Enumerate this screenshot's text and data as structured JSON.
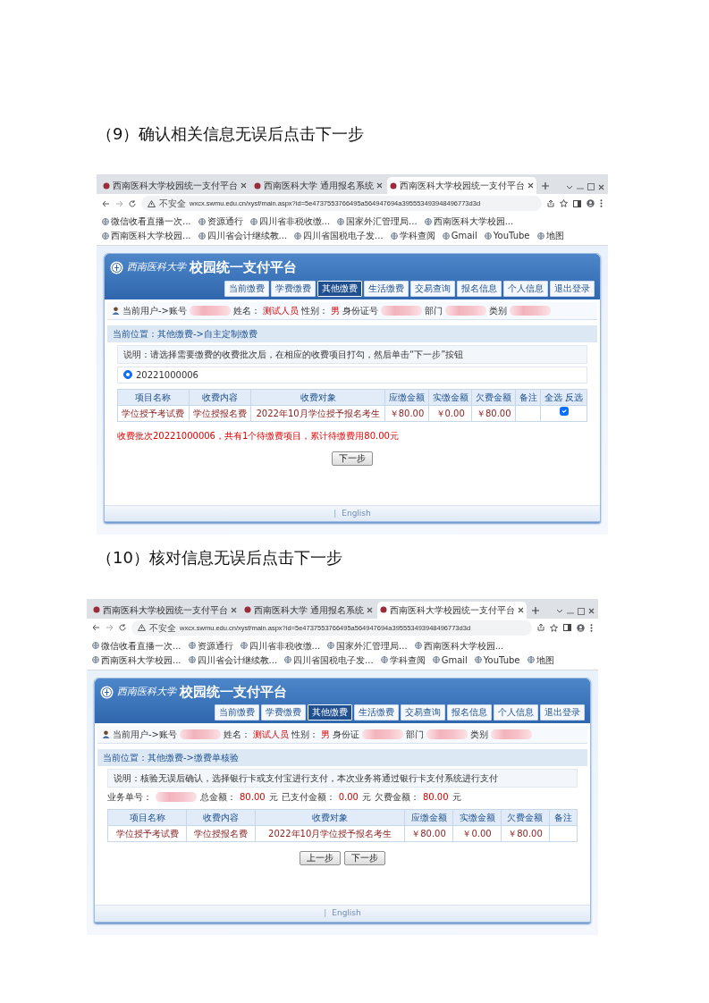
{
  "steps": [
    {
      "caption": "（9）确认相关信息无误后点击下一步",
      "browser": {
        "tabs": [
          {
            "title": "西南医科大学校园统一支付平台",
            "selected": false
          },
          {
            "title": "西南医科大学 通用报名系统",
            "selected": false
          },
          {
            "title": "西南医科大学校园统一支付平台",
            "selected": true
          }
        ],
        "security": "不安全",
        "url": "wxcx.swmu.edu.cn/xysf/main.aspx?id=5e4737553766495a5649476​94a395553493948496773d3d",
        "bookmarks": [
          "微信收看直播一次...",
          "资源通行",
          "四川省非税收缴...",
          "国家外汇管理局...",
          "西南医科大学校园...",
          "西南医科大学校园...",
          "四川省会计继续教...",
          "四川省国税电子发...",
          "学科查阅",
          "Gmail",
          "YouTube",
          "地图"
        ]
      },
      "site": {
        "logo_text": "西南医科大学",
        "title": "校园统一支付平台",
        "nav": [
          {
            "label": "当前缴费",
            "selected": false
          },
          {
            "label": "学费缴费",
            "selected": false
          },
          {
            "label": "其他缴费",
            "selected": true
          },
          {
            "label": "生活缴费",
            "selected": false
          },
          {
            "label": "交易查询",
            "selected": false
          },
          {
            "label": "报名信息",
            "selected": false
          },
          {
            "label": "个人信息",
            "selected": false
          },
          {
            "label": "退出登录",
            "selected": false
          }
        ],
        "user": [
          {
            "kind": "label",
            "text": "当前用户->账号"
          },
          {
            "kind": "redacted"
          },
          {
            "kind": "label",
            "text": "姓名："
          },
          {
            "kind": "value",
            "text": "测试人员"
          },
          {
            "kind": "label",
            "text": "性别："
          },
          {
            "kind": "value",
            "text": "男"
          },
          {
            "kind": "label",
            "text": "身份证号"
          },
          {
            "kind": "redacted"
          },
          {
            "kind": "label",
            "text": "部门"
          },
          {
            "kind": "redacted"
          },
          {
            "kind": "label",
            "text": "类别"
          },
          {
            "kind": "redacted"
          }
        ],
        "breadcrumb": "当前位置：其他缴费->自主定制缴费",
        "note": "说明：请选择需要缴费的收费批次后，在相应的收费项目打勾，然后单击“下一步”按钮",
        "batch": {
          "label": "20221000006",
          "selected": true
        },
        "table": {
          "columns": [
            {
              "label": "项目名称",
              "kind": "text"
            },
            {
              "label": "收费内容",
              "kind": "text"
            },
            {
              "label": "收费对象",
              "kind": "text"
            },
            {
              "label": "应缴金额",
              "kind": "text"
            },
            {
              "label": "实缴金额",
              "kind": "text"
            },
            {
              "label": "欠费金额",
              "kind": "text"
            },
            {
              "label": "备注",
              "kind": "text"
            },
            {
              "label": "全选 反选",
              "kind": "check"
            }
          ],
          "rows": [
            {
              "cells": [
                "学位授予考试费",
                "学位授报名费",
                "2022年10月学位授予报名考生",
                "￥80.00",
                "￥0.00",
                "￥80.00"
              ],
              "checked": true
            }
          ]
        },
        "message": "收费批次20221000006，共有1个待缴费项目，累计待缴费用80.00元",
        "buttons": [
          "下一步"
        ],
        "footer": {
          "separator": "|",
          "link": "English"
        }
      }
    },
    {
      "caption": "（10）核对信息无误后点击下一步",
      "browser": {
        "tabs": [
          {
            "title": "西南医科大学校园统一支付平台",
            "selected": false
          },
          {
            "title": "西南医科大学 通用报名系统",
            "selected": false
          },
          {
            "title": "西南医科大学校园统一支付平台",
            "selected": true
          }
        ],
        "security": "不安全",
        "url": "wxcx.swmu.edu.cn/xysf/main.aspx?id=5e4737553766495a564947694a395553493948496773d3d",
        "bookmarks": [
          "微信收看直播一次...",
          "资源通行",
          "四川省非税收缴...",
          "国家外汇管理局...",
          "西南医科大学校园...",
          "西南医科大学校园...",
          "四川省会计继续教...",
          "四川省国税电子发...",
          "学科查阅",
          "Gmail",
          "YouTube",
          "地图"
        ]
      },
      "site": {
        "logo_text": "西南医科大学",
        "title": "校园统一支付平台",
        "nav": [
          {
            "label": "当前缴费",
            "selected": false
          },
          {
            "label": "学费缴费",
            "selected": false
          },
          {
            "label": "其他缴费",
            "selected": true
          },
          {
            "label": "生活缴费",
            "selected": false
          },
          {
            "label": "交易查询",
            "selected": false
          },
          {
            "label": "报名信息",
            "selected": false
          },
          {
            "label": "个人信息",
            "selected": false
          },
          {
            "label": "退出登录",
            "selected": false
          }
        ],
        "user": [
          {
            "kind": "label",
            "text": "当前用户->账号"
          },
          {
            "kind": "redacted"
          },
          {
            "kind": "label",
            "text": "姓名："
          },
          {
            "kind": "value",
            "text": "测试人员"
          },
          {
            "kind": "label",
            "text": "性别："
          },
          {
            "kind": "value",
            "text": "男"
          },
          {
            "kind": "label",
            "text": "身份证"
          },
          {
            "kind": "redacted"
          },
          {
            "kind": "label",
            "text": "部门"
          },
          {
            "kind": "redacted"
          },
          {
            "kind": "label",
            "text": "类别"
          },
          {
            "kind": "redacted"
          }
        ],
        "breadcrumb": "当前位置：其他缴费->缴费单核验",
        "note": "说明：核验无误后确认，选择银行卡或支付宝进行支付，本次业务将通过银行卡支付系统进行支付",
        "summary": [
          {
            "kind": "label",
            "text": "业务单号："
          },
          {
            "kind": "redacted"
          },
          {
            "kind": "label",
            "text": "总金额："
          },
          {
            "kind": "value",
            "text": "80.00"
          },
          {
            "kind": "label",
            "text": "元"
          },
          {
            "kind": "label",
            "text": "已支付金额："
          },
          {
            "kind": "value",
            "text": "0.00"
          },
          {
            "kind": "label",
            "text": "元"
          },
          {
            "kind": "label",
            "text": "欠费金额："
          },
          {
            "kind": "value",
            "text": "80.00"
          },
          {
            "kind": "label",
            "text": "元"
          }
        ],
        "table": {
          "columns": [
            {
              "label": "项目名称",
              "kind": "text"
            },
            {
              "label": "收费内容",
              "kind": "text"
            },
            {
              "label": "收费对象",
              "kind": "text"
            },
            {
              "label": "应缴金额",
              "kind": "text"
            },
            {
              "label": "实缴金额",
              "kind": "text"
            },
            {
              "label": "欠费金额",
              "kind": "text"
            },
            {
              "label": "备注",
              "kind": "text"
            }
          ],
          "rows": [
            {
              "cells": [
                "学位授予考试费",
                "学位授报名费",
                "2022年10月学位授予报名考生",
                "￥80.00",
                "￥0.00",
                "￥80.00"
              ]
            }
          ]
        },
        "buttons": [
          "上一步",
          "下一步"
        ],
        "footer": {
          "separator": "|",
          "link": "English"
        }
      }
    }
  ]
}
